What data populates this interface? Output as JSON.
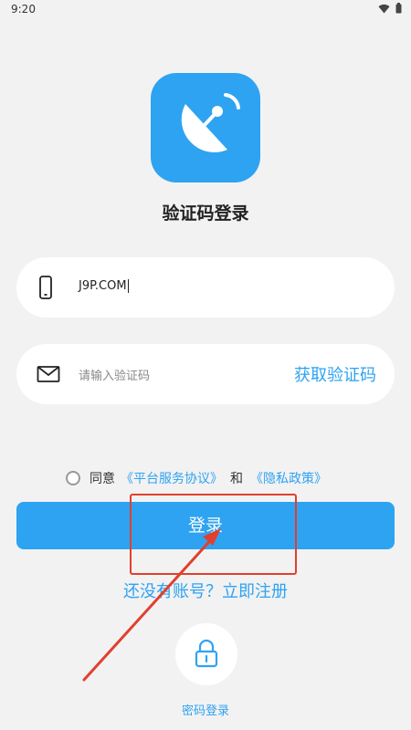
{
  "status_bar": {
    "time": "9:20",
    "icons": [
      "wifi-icon",
      "battery-icon"
    ]
  },
  "app_icon": {
    "icon": "satellite-dish-icon",
    "bg_color": "#2ea3f2"
  },
  "page_title": "验证码登录",
  "phone_field": {
    "icon": "phone-icon",
    "value": "J9P.COM"
  },
  "code_field": {
    "icon": "mail-icon",
    "placeholder": "请输入验证码",
    "get_code_label": "获取验证码"
  },
  "agreement": {
    "prefix": "同意",
    "terms_link": "《平台服务协议》",
    "and_text": "和",
    "privacy_link": "《隐私政策》",
    "checked": false
  },
  "login_button": {
    "label": "登录"
  },
  "register_link": "还没有账号？立即注册",
  "password_login": {
    "icon": "lock-icon",
    "label": "密码登录"
  },
  "accent_color": "#2ea3f2",
  "annotation_color": "#e0402e"
}
